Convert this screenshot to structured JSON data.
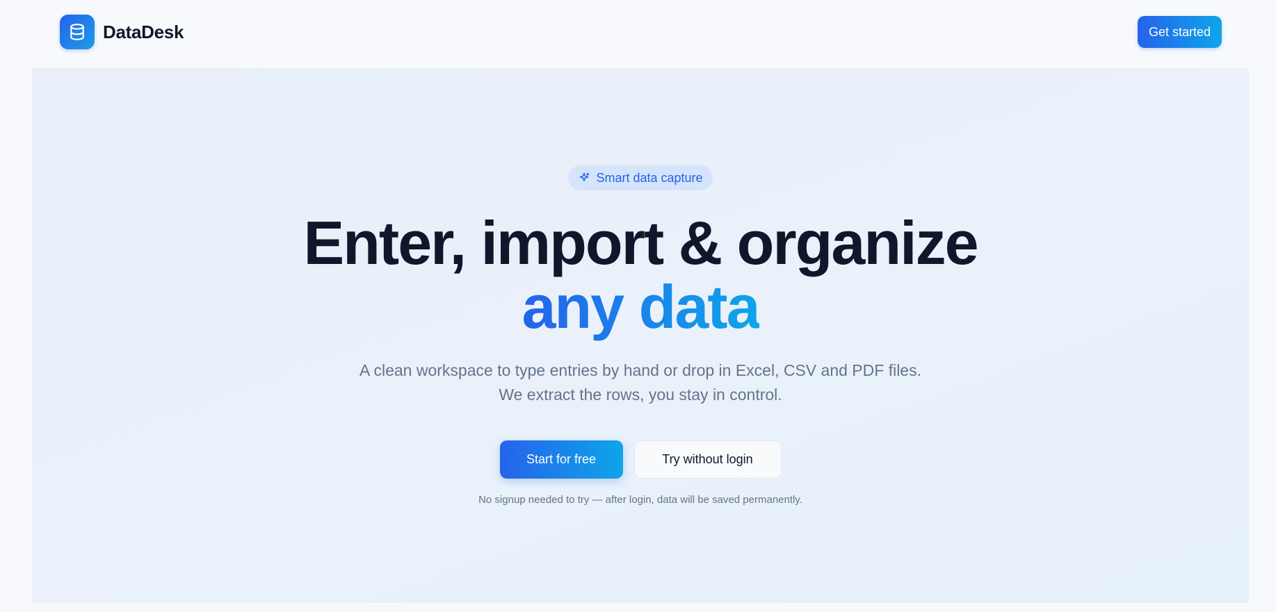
{
  "brand": {
    "name": "DataDesk",
    "logo_icon": "database-icon",
    "accent_start": "#2563eb",
    "accent_end": "#0ea5e9"
  },
  "header": {
    "get_started_label": "Get started"
  },
  "hero": {
    "badge": {
      "icon": "sparkle-icon",
      "label": "Smart data capture"
    },
    "headline_line1": "Enter, import & organize",
    "headline_line2": "any data",
    "subtitle": "A clean workspace to type entries by hand or drop in Excel, CSV and PDF files. We extract the rows, you stay in control.",
    "primary_cta": "Start for free",
    "secondary_cta": "Try without login",
    "note": "No signup needed to try — after login, data will be saved permanently."
  }
}
